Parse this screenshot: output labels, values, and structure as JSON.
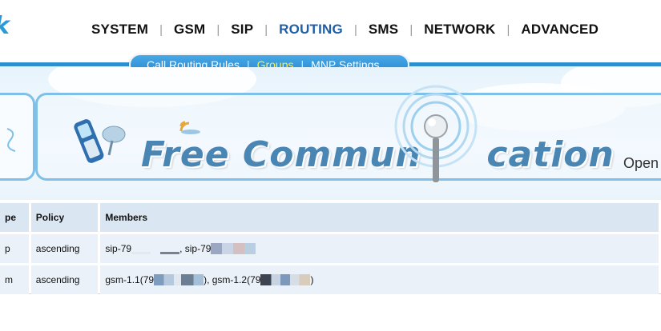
{
  "topnav": {
    "items": [
      "SYSTEM",
      "GSM",
      "SIP",
      "ROUTING",
      "SMS",
      "NETWORK",
      "ADVANCED"
    ],
    "active": "ROUTING"
  },
  "subnav": {
    "items": [
      "Call Routing Rules",
      "Groups",
      "MNP Settings"
    ],
    "active": "Groups"
  },
  "banner": {
    "text_left": "Free Commun",
    "text_right": "cation",
    "corner_text": "Open"
  },
  "table": {
    "headers": [
      "pe",
      "Policy",
      "Members"
    ],
    "rows": [
      {
        "type": "p",
        "policy": "ascending",
        "members_a": "sip-79",
        "members_mid": ", sip-79",
        "members_end": ""
      },
      {
        "type": "m",
        "policy": "ascending",
        "members_a": "gsm-1.1(79",
        "members_mid": "), gsm-1.2(79",
        "members_end": ")"
      }
    ]
  },
  "colors": {
    "accent": "#2e8fd0",
    "active_nav": "#1f5fa8",
    "active_sub": "#fff04a",
    "header_bg": "#dae7f2",
    "row_bg": "#eaf1f8"
  }
}
